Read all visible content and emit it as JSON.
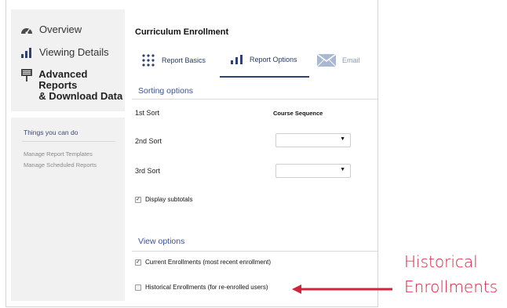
{
  "sidebar": {
    "nav": [
      {
        "label": "Overview",
        "icon": "speedometer-icon"
      },
      {
        "label": "Viewing Details",
        "icon": "bar-chart-icon"
      },
      {
        "label_line1": "Advanced Reports",
        "label_line2": "& Download Data",
        "icon": "report-sign-icon",
        "active": true
      }
    ],
    "things": {
      "title": "Things you can do",
      "links": [
        "Manage Report Templates",
        "Manage Scheduled Reports"
      ]
    }
  },
  "main": {
    "title": "Curriculum Enrollment",
    "tabs": [
      {
        "label": "Report Basics",
        "icon": "dots-grid-icon"
      },
      {
        "label": "Report Options",
        "icon": "bar-chart-icon",
        "active": true
      },
      {
        "label": "Email",
        "icon": "envelope-icon"
      }
    ],
    "sorting": {
      "title": "Sorting options",
      "sort1": {
        "label": "1st Sort",
        "value": "Course Sequence"
      },
      "sort2": {
        "label": "2nd Sort",
        "value": ""
      },
      "sort3": {
        "label": "3rd Sort",
        "value": ""
      },
      "subtotals": {
        "label": "Display subtotals",
        "checked": true
      }
    },
    "view": {
      "title": "View options",
      "current": {
        "label": "Current Enrollments (most recent enrollment)",
        "checked": true
      },
      "historical": {
        "label": "Historical Enrollments (for re-enrolled users)",
        "checked": false
      }
    }
  },
  "annotation": {
    "line1": "Historical",
    "line2": "Enrollments",
    "color": "#d2233c"
  },
  "colors": {
    "accent": "#3b5195",
    "tab_active": "#2f4175",
    "sidebar_bg": "#f1f1f1"
  }
}
